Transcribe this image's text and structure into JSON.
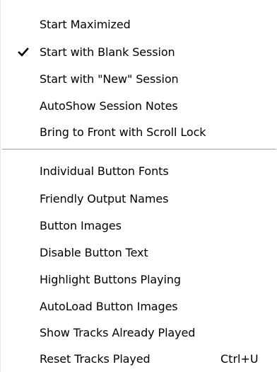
{
  "menu": {
    "group1": [
      {
        "label": "Start Maximized",
        "checked": false
      },
      {
        "label": "Start with Blank Session",
        "checked": true
      },
      {
        "label": "Start with \"New\" Session",
        "checked": false
      },
      {
        "label": "AutoShow Session Notes",
        "checked": false
      },
      {
        "label": "Bring to Front with Scroll Lock",
        "checked": false
      }
    ],
    "group2": [
      {
        "label": "Individual Button Fonts"
      },
      {
        "label": "Friendly Output Names"
      },
      {
        "label": "Button Images"
      },
      {
        "label": "Disable Button Text"
      },
      {
        "label": "Highlight Buttons Playing"
      },
      {
        "label": "AutoLoad Button Images"
      },
      {
        "label": "Show Tracks Already Played"
      },
      {
        "label": "Reset Tracks Played",
        "shortcut": "Ctrl+U"
      }
    ]
  },
  "icons": {
    "check": "checkmark-icon"
  },
  "colors": {
    "background": "#ffffff",
    "text": "#000000",
    "separator_dark": "#a0a0a0"
  }
}
